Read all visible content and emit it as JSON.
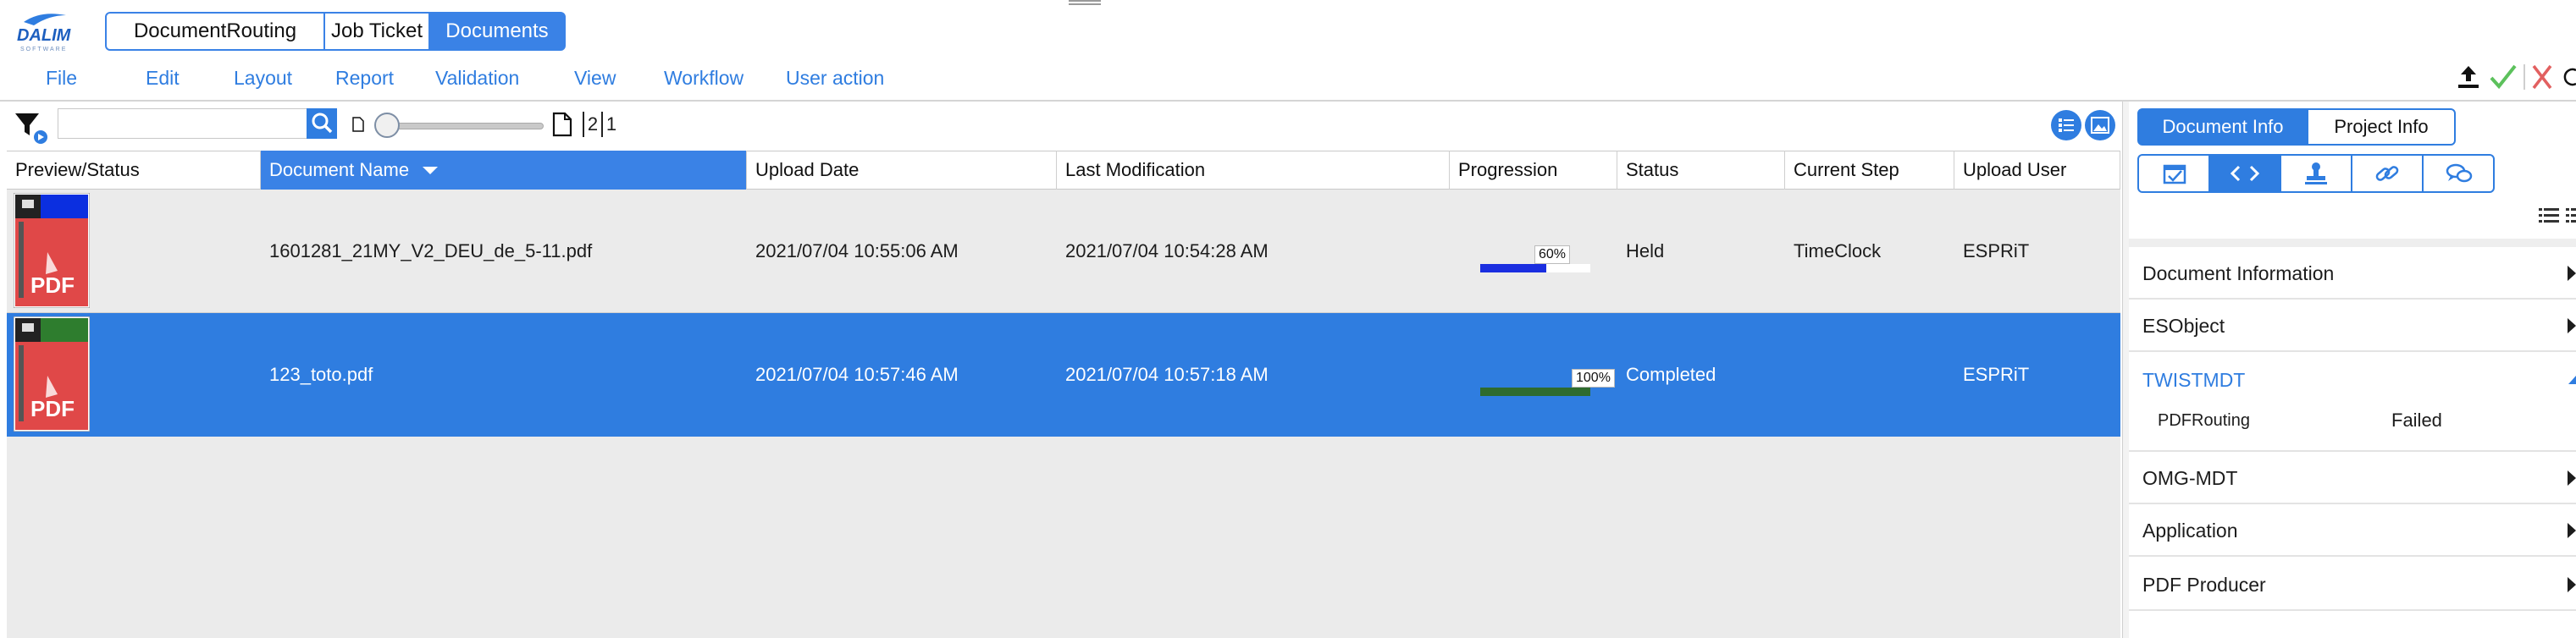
{
  "app": {
    "logo_text": "DALIM SOFTWARE",
    "top_tabs": [
      {
        "label": "DocumentRouting"
      },
      {
        "label": "Job Ticket"
      },
      {
        "label": "Documents"
      }
    ],
    "active_top_tab": "Documents"
  },
  "menu": {
    "items": [
      {
        "label": "File"
      },
      {
        "label": "Edit"
      },
      {
        "label": "Layout"
      },
      {
        "label": "Report"
      },
      {
        "label": "Validation"
      },
      {
        "label": "View"
      },
      {
        "label": "Workflow"
      },
      {
        "label": "User action"
      }
    ]
  },
  "toolbar": {
    "search": {
      "value": "",
      "placeholder": ""
    },
    "zoom_slider_value": 0,
    "page_counts": [
      "2",
      "1"
    ]
  },
  "grid": {
    "columns": [
      {
        "label": "Preview/Status"
      },
      {
        "label": "Document Name",
        "sorted": true,
        "sort_dir": "desc"
      },
      {
        "label": "Upload Date"
      },
      {
        "label": "Last Modification"
      },
      {
        "label": "Progression"
      },
      {
        "label": "Status"
      },
      {
        "label": "Current Step"
      },
      {
        "label": "Upload User"
      }
    ],
    "rows": [
      {
        "preview_label": "PDF",
        "status_color": "#0b2fe0",
        "document_name": "1601281_21MY_V2_DEU_de_5-11.pdf",
        "upload_date": "2021/07/04 10:55:06 AM",
        "last_modification": "2021/07/04 10:54:28 AM",
        "progression": 60,
        "progression_label": "60%",
        "progress_color": "#1a2ee0",
        "status": "Held",
        "current_step": "TimeClock",
        "upload_user": "ESPRiT",
        "selected": false
      },
      {
        "preview_label": "PDF",
        "status_color": "#2e7d2e",
        "document_name": "123_toto.pdf",
        "upload_date": "2021/07/04 10:57:46 AM",
        "last_modification": "2021/07/04 10:57:18 AM",
        "progression": 100,
        "progression_label": "100%",
        "progress_color": "#2e6b2e",
        "status": "Completed",
        "current_step": "",
        "upload_user": "ESPRiT",
        "selected": true
      }
    ]
  },
  "panel": {
    "tabs": [
      {
        "label": "Document Info"
      },
      {
        "label": "Project Info"
      }
    ],
    "active_tab": "Document Info",
    "segments": [
      {
        "icon": "approval-calendar-icon"
      },
      {
        "icon": "code-brackets-icon"
      },
      {
        "icon": "stamp-icon"
      },
      {
        "icon": "link-icon"
      },
      {
        "icon": "chat-bubbles-icon"
      }
    ],
    "active_segment": 1,
    "sections": [
      {
        "label": "Document Information",
        "open": false
      },
      {
        "label": "ESObject",
        "open": false
      },
      {
        "label": "TWISTMDT",
        "open": true,
        "entries": [
          {
            "key": "PDFRouting",
            "value": "Failed"
          }
        ]
      },
      {
        "label": "OMG-MDT",
        "open": false
      },
      {
        "label": "Application",
        "open": false
      },
      {
        "label": "PDF Producer",
        "open": false
      }
    ]
  },
  "colors": {
    "accent": "#2f7de0",
    "selected_row": "#2f7de0",
    "check": "#5cc15c",
    "cancel": "#e26060"
  }
}
